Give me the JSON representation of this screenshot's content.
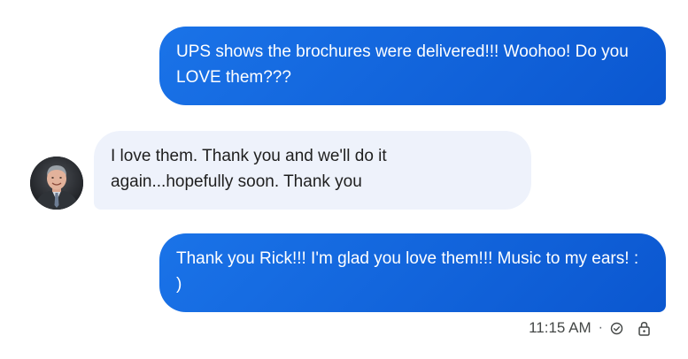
{
  "messages": [
    {
      "direction": "outgoing",
      "text": "UPS shows the brochures were delivered!!! Woohoo! Do you LOVE them???"
    },
    {
      "direction": "incoming",
      "text": "I love them. Thank you and we'll do it again...hopefully soon. Thank you"
    },
    {
      "direction": "outgoing",
      "text": "Thank you Rick!!! I'm glad you love them!!! Music to my ears! : )"
    }
  ],
  "status": {
    "time": "11:15 AM",
    "separator": "·",
    "delivered_icon": "check-circle-icon",
    "lock_icon": "lock-icon"
  },
  "colors": {
    "outgoing_bubble": "#1a73e8",
    "incoming_bubble": "#eef2fb"
  }
}
